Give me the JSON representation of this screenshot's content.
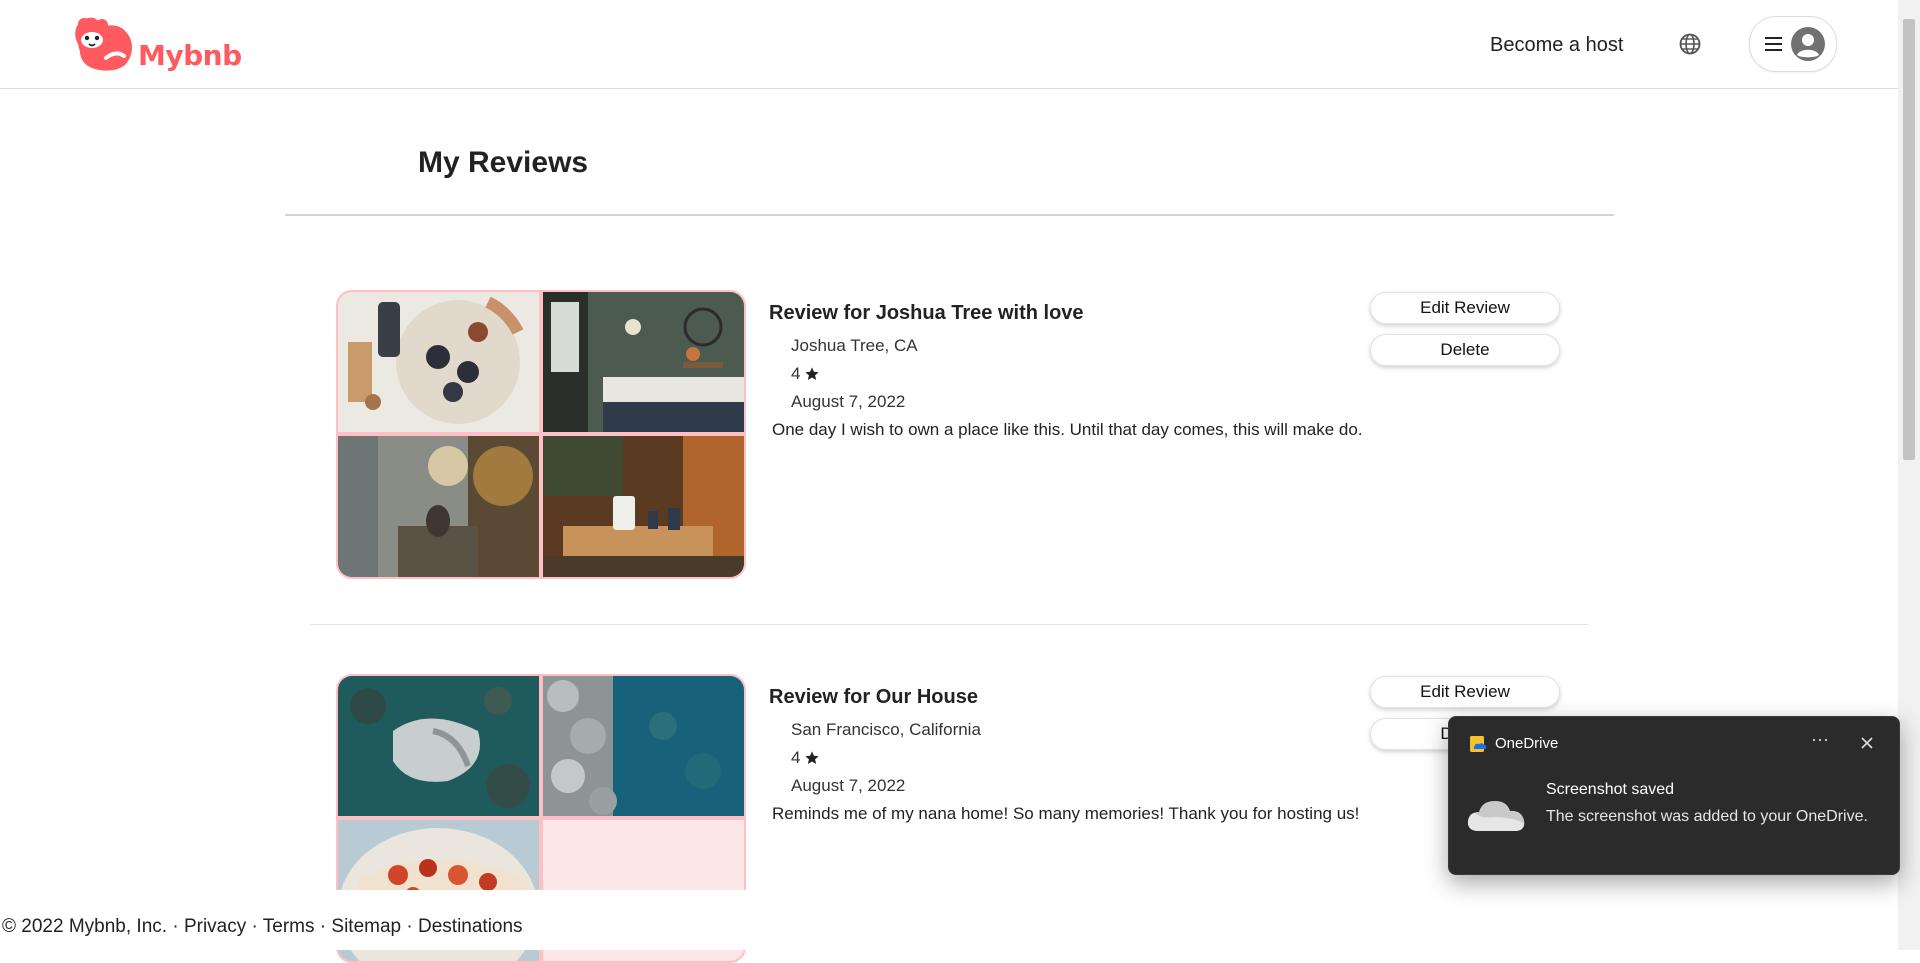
{
  "header": {
    "logo_text": "Mybnb",
    "become_host": "Become a host"
  },
  "page": {
    "title": "My Reviews"
  },
  "reviews": [
    {
      "title": "Review for Joshua Tree with love",
      "location": "Joshua Tree, CA",
      "rating": "4",
      "date": "August 7, 2022",
      "body": "One day I wish to own a place like this. Until that day comes, this will make do.",
      "edit_label": "Edit Review",
      "delete_label": "Delete"
    },
    {
      "title": "Review for Our House",
      "location": "San Francisco, California",
      "rating": "4",
      "date": "August 7, 2022",
      "body": "Reminds me of my nana home! So many memories! Thank you for hosting us!",
      "edit_label": "Edit Review",
      "delete_label": "Delete"
    }
  ],
  "footer": {
    "copyright": "© 2022 Mybnb, Inc.",
    "sep": " · ",
    "links": [
      "Privacy",
      "Terms",
      "Sitemap",
      "Destinations"
    ]
  },
  "toast": {
    "app_name": "OneDrive",
    "more": "···",
    "title": "Screenshot saved",
    "body": "The screenshot was added to your OneDrive."
  },
  "colors": {
    "brand": "#ff5a5f",
    "gallery_border": "#ffc0c5",
    "toast_bg": "#2b2b2b"
  }
}
